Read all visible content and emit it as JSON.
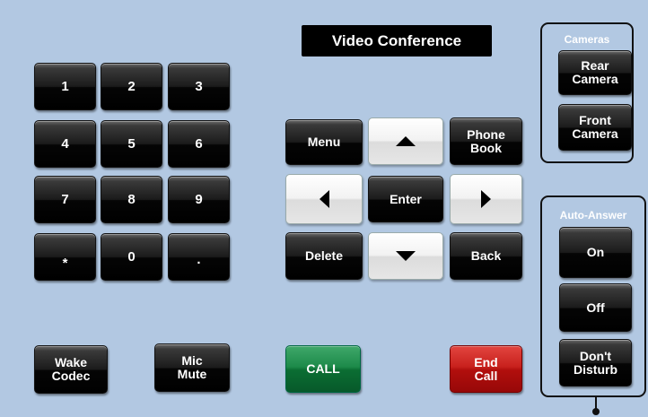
{
  "title": "Video Conference",
  "keypad": {
    "keys": [
      "1",
      "2",
      "3",
      "4",
      "5",
      "6",
      "7",
      "8",
      "9",
      "*",
      "0",
      "."
    ]
  },
  "navigation": {
    "menu": "Menu",
    "phonebook": "Phone Book",
    "enter": "Enter",
    "delete": "Delete",
    "back": "Back",
    "up_icon": "triangle-up",
    "down_icon": "triangle-down",
    "left_icon": "triangle-left",
    "right_icon": "triangle-right"
  },
  "bottom": {
    "wake_codec": "Wake Codec",
    "mic_mute": "Mic Mute",
    "call": "CALL",
    "end_call": "End Call"
  },
  "cameras": {
    "label": "Cameras",
    "rear": "Rear Camera",
    "front": "Front Camera"
  },
  "auto_answer": {
    "label": "Auto-Answer",
    "on": "On",
    "off": "Off",
    "dnd": "Don't Disturb"
  },
  "colors": {
    "background": "#b2c8e2",
    "call": "#0b6e33",
    "end_call": "#b20f0d"
  }
}
